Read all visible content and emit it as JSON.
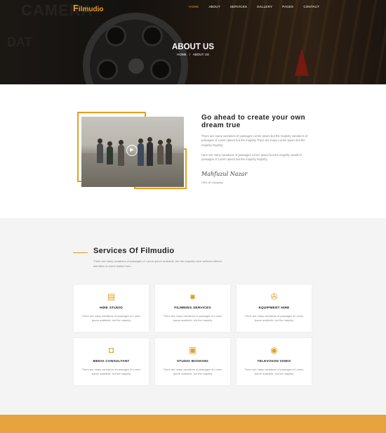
{
  "brand": {
    "logo_f": "F",
    "logo_rest": "ilmudio"
  },
  "nav": {
    "items": [
      {
        "label": "HOME",
        "active": true
      },
      {
        "label": "ABOUT",
        "active": false
      },
      {
        "label": "SERVICES",
        "active": false
      },
      {
        "label": "GALLERY",
        "active": false
      },
      {
        "label": "PAGES",
        "active": false
      },
      {
        "label": "CONTACT",
        "active": false
      }
    ]
  },
  "hero": {
    "title": "ABOUT US",
    "breadcrumb_home": "HOME",
    "breadcrumb_sep": "/",
    "breadcrumb_current": "ABOUT US",
    "bg_text_1": "CAMERA",
    "bg_text_2": "DAT"
  },
  "about": {
    "heading_line1": "Go ahead to create your own",
    "heading_line2": "dream true",
    "paragraph1": "There are many variations of passages Lorem ipsum but the majority variations of passages of Lorem ipsum but the majority There are many Lorem ipsum but the majority majority.",
    "paragraph2": "Here are many variations of passages Lorem ipsum but the majority varaitl of passages of Lorem ipsum but the majority majority.",
    "signature": "Mahfuzul Nazar",
    "role": "CEO Of Company",
    "play_icon": "play-icon"
  },
  "services": {
    "title": "Services Of Filmudio",
    "description": "There are many variations of passages of Lorem ipsum available, but the majority have suffered altered alteration in some leaked form.",
    "cards": [
      {
        "title": "HIRE STUDIO",
        "icon": "film-strip-icon",
        "desc": "There are many variations of passages of Lorem ipsum available, but the majority"
      },
      {
        "title": "FILMMING SERVICES",
        "icon": "video-camera-icon",
        "desc": "There are many variations of passages of Lorem ipsum available, but the majority"
      },
      {
        "title": "EQUIPMENT HIRE",
        "icon": "film-reel-icon",
        "desc": "There are many variations of passages of Lorem ipsum available, but the majority"
      },
      {
        "title": "MEDIA CONSULTANT",
        "icon": "camera-icon",
        "desc": "There are many variations of passages of Lorem ipsum available, but the majority"
      },
      {
        "title": "STUDIO BOOKING",
        "icon": "clapper-icon",
        "desc": "There are many variations of passages of Lorem ipsum available, but the majority"
      },
      {
        "title": "TELEVISION VIDEO",
        "icon": "disc-icon",
        "desc": "There are many variations of passages of Lorem ipsum available, but the majority"
      }
    ]
  },
  "colors": {
    "accent": "#e79d1f",
    "footer": "#e7a33e",
    "section_bg": "#f4f4f4"
  }
}
